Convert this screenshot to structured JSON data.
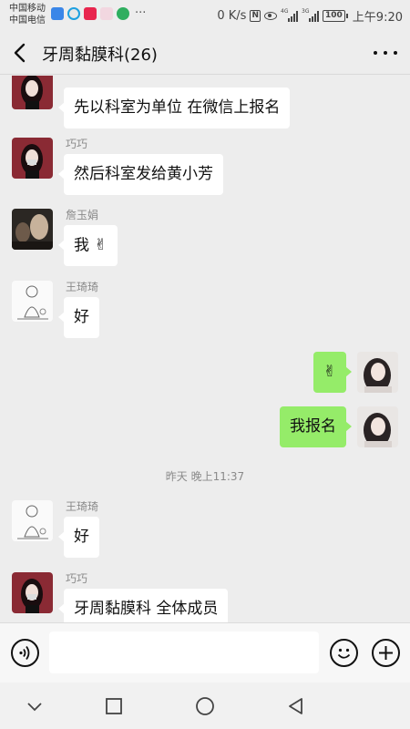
{
  "status_bar": {
    "carrier1": "中国移动",
    "carrier2": "中国电信",
    "more": "···",
    "speed": "0 K/s",
    "nfc": "N",
    "signal1_tag": "4G",
    "signal2_tag": "3G",
    "battery": "100",
    "time": "上午9:20"
  },
  "header": {
    "title": "牙周黏膜科(26)"
  },
  "messages": [
    {
      "sender": "",
      "text": "先以科室为单位 在微信上报名"
    },
    {
      "sender": "巧巧",
      "text": "然后科室发给黄小芳"
    },
    {
      "sender": "詹玉娟",
      "text": "我"
    },
    {
      "sender": "王琦琦",
      "text": "好"
    },
    {
      "text": ""
    },
    {
      "text": "我报名"
    },
    {
      "sender": "王琦琦",
      "text": "好"
    },
    {
      "sender": "巧巧",
      "text": "牙周黏膜科 全体成员"
    }
  ],
  "timestamp": "昨天 晚上11:37",
  "icons": {
    "back": "chevron-left-icon",
    "more": "more-dots-icon",
    "voice": "voice-icon",
    "emoji": "smiley-icon",
    "plus": "plus-icon",
    "nav_down": "chevron-down-icon",
    "nav_recent": "square-icon",
    "nav_home": "circle-icon",
    "nav_back": "triangle-back-icon"
  },
  "colors": {
    "background": "#ededed",
    "outgoing_bubble": "#95ec69",
    "incoming_bubble": "#ffffff"
  }
}
